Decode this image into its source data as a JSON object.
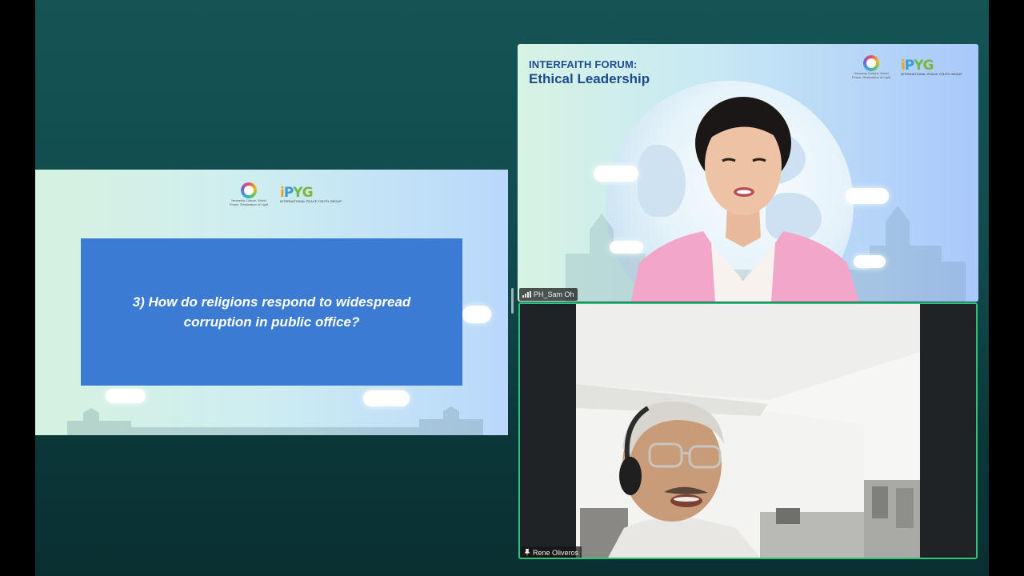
{
  "slide": {
    "logo_sub": "Heavenly Culture, World Peace, Restoration of Light",
    "ipyg_letters": [
      "i",
      "P",
      "Y",
      "G"
    ],
    "ipyg_sub": "INTERNATIONAL PEACE YOUTH GROUP",
    "question": "3) How do religions respond to widespread corruption in public office?"
  },
  "speaker_tile": {
    "title_line1": "INTERFAITH FORUM:",
    "title_line2": "Ethical Leadership",
    "participant_name": "PH_Sam Oh",
    "icon": "signal-strength-icon"
  },
  "active_tile": {
    "participant_name": "Rene Oliveros",
    "icon": "pin-icon",
    "active_border_color": "#2fc37a"
  },
  "colors": {
    "background": "#145454",
    "question_box": "#3c7bd4",
    "title_blue": "#1d4b8c"
  }
}
